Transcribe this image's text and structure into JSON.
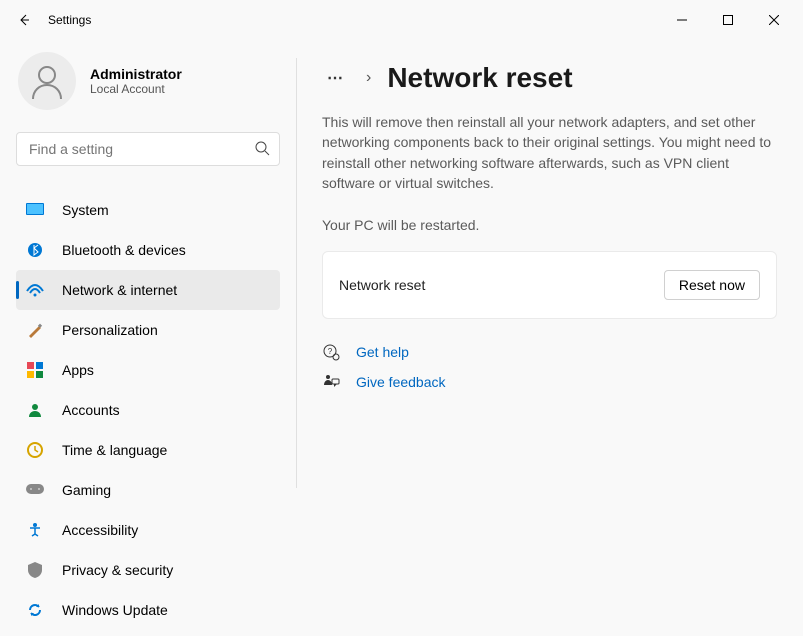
{
  "app_title": "Settings",
  "account": {
    "name": "Administrator",
    "sub": "Local Account"
  },
  "search": {
    "placeholder": "Find a setting"
  },
  "nav": [
    {
      "label": "System"
    },
    {
      "label": "Bluetooth & devices"
    },
    {
      "label": "Network & internet",
      "selected": true
    },
    {
      "label": "Personalization"
    },
    {
      "label": "Apps"
    },
    {
      "label": "Accounts"
    },
    {
      "label": "Time & language"
    },
    {
      "label": "Gaming"
    },
    {
      "label": "Accessibility"
    },
    {
      "label": "Privacy & security"
    },
    {
      "label": "Windows Update"
    }
  ],
  "page": {
    "title": "Network reset",
    "description": "This will remove then reinstall all your network adapters, and set other networking components back to their original settings. You might need to reinstall other networking software afterwards, such as VPN client software or virtual switches.",
    "restart_note": "Your PC will be restarted.",
    "card_label": "Network reset",
    "reset_button": "Reset now",
    "help_link": "Get help",
    "feedback_link": "Give feedback"
  }
}
